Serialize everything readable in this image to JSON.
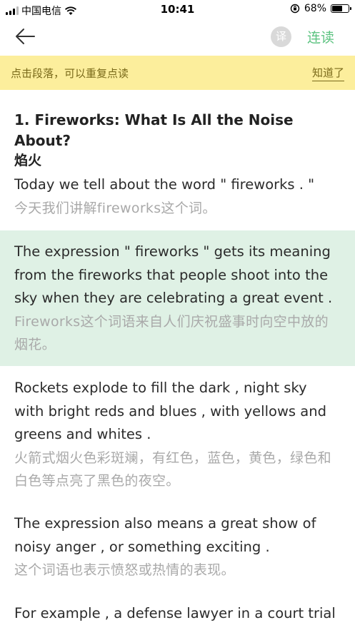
{
  "status_bar": {
    "carrier": "中国电信",
    "time": "10:41",
    "battery_percent": "68%",
    "battery_level": 0.68
  },
  "nav": {
    "translate_label": "译",
    "continuous_label": "连读",
    "accent_color": "#5dc381"
  },
  "tip": {
    "text": "点击段落，可以重复点读",
    "dismiss_label": "知道了",
    "background": "#fcee9c"
  },
  "article": {
    "title_en": "1. Fireworks: What Is All the Noise About?",
    "title_zh": "焰火",
    "paragraphs": [
      {
        "en": "Today we tell about the word \" fireworks . \"",
        "zh": "今天我们讲解fireworks这个词。",
        "active": false
      },
      {
        "en": "The expression \" fireworks \" gets its meaning from the fireworks that people shoot into the sky when they are celebrating a great event .",
        "zh": "Fireworks这个词语来自人们庆祝盛事时向空中放的烟花。",
        "active": true
      },
      {
        "en": "Rockets explode to fill the dark , night sky with bright reds and blues , with yellows and greens and whites .",
        "zh": "火箭式烟火色彩斑斓，有红色，蓝色，黄色，绿色和白色等点亮了黑色的夜空。",
        "active": false
      },
      {
        "en": "The expression also means a great show of noisy anger , or something exciting .",
        "zh": "这个词语也表示愤怒或热情的表现。",
        "active": false
      },
      {
        "en": "For example , a defense lawyer in a court trial",
        "zh": "",
        "active": false
      }
    ]
  }
}
